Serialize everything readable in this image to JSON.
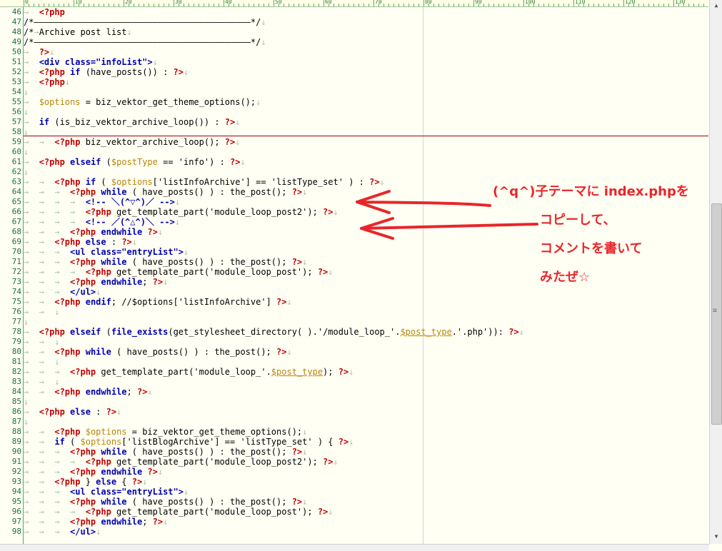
{
  "ruler": {
    "labels": [
      "0",
      "10",
      "20",
      "30",
      "40",
      "50",
      "60",
      "70",
      "80",
      "90",
      "100",
      "110",
      "120",
      "130"
    ]
  },
  "lines": [
    {
      "n": "46",
      "t": [
        [
          "marker",
          "→  "
        ],
        [
          "tag",
          "<?php"
        ]
      ]
    },
    {
      "n": "47",
      "t": [
        [
          "comment",
          "/*――――――――――――――――――――――――――――――――――――――――――*/"
        ],
        [
          "marker",
          "↓"
        ]
      ]
    },
    {
      "n": "48",
      "t": [
        [
          "comment",
          "/*"
        ],
        [
          "marker",
          "→"
        ],
        [
          "comment",
          "Archive post list"
        ],
        [
          "marker",
          "↓"
        ]
      ]
    },
    {
      "n": "49",
      "t": [
        [
          "comment",
          "/*――――――――――――――――――――――――――――――――――――――――――*/"
        ],
        [
          "marker",
          "↓"
        ]
      ]
    },
    {
      "n": "50",
      "t": [
        [
          "marker",
          "→  "
        ],
        [
          "tag",
          "?>"
        ],
        [
          "marker",
          "↓"
        ]
      ]
    },
    {
      "n": "51",
      "t": [
        [
          "marker",
          "→  "
        ],
        [
          "html",
          "<div class=\"infoList\">"
        ],
        [
          "marker",
          "↓"
        ]
      ]
    },
    {
      "n": "52",
      "t": [
        [
          "marker",
          "→  "
        ],
        [
          "tag",
          "<?php"
        ],
        [
          "default",
          " "
        ],
        [
          "keyword",
          "if"
        ],
        [
          "default",
          " (have_posts()) : "
        ],
        [
          "tag",
          "?>"
        ],
        [
          "marker",
          "↓"
        ]
      ]
    },
    {
      "n": "53",
      "t": [
        [
          "marker",
          "→  "
        ],
        [
          "tag",
          "<?php"
        ],
        [
          "marker",
          "↓"
        ]
      ]
    },
    {
      "n": "54",
      "t": [
        [
          "marker",
          "↓"
        ]
      ]
    },
    {
      "n": "55",
      "t": [
        [
          "marker",
          "→  "
        ],
        [
          "var",
          "$options"
        ],
        [
          "default",
          " = biz_vektor_get_theme_options();"
        ],
        [
          "marker",
          "↓"
        ]
      ]
    },
    {
      "n": "56",
      "t": [
        [
          "marker",
          "↓"
        ]
      ]
    },
    {
      "n": "57",
      "t": [
        [
          "marker",
          "→  "
        ],
        [
          "keyword",
          "if"
        ],
        [
          "default",
          " (is_biz_vektor_archive_loop()) : "
        ],
        [
          "tag",
          "?>"
        ],
        [
          "marker",
          "↓"
        ]
      ]
    },
    {
      "n": "58",
      "t": [
        [
          "marker",
          "↓"
        ]
      ]
    },
    {
      "n": "59",
      "t": [
        [
          "marker",
          "→  →  "
        ],
        [
          "tag",
          "<?php"
        ],
        [
          "default",
          " biz_vektor_archive_loop(); "
        ],
        [
          "tag",
          "?>"
        ],
        [
          "marker",
          "↓"
        ]
      ]
    },
    {
      "n": "60",
      "t": [
        [
          "marker",
          "↓"
        ]
      ]
    },
    {
      "n": "61",
      "t": [
        [
          "marker",
          "→  "
        ],
        [
          "tag",
          "<?php"
        ],
        [
          "default",
          " "
        ],
        [
          "keyword",
          "elseif"
        ],
        [
          "default",
          " ("
        ],
        [
          "var",
          "$postType"
        ],
        [
          "default",
          " == 'info') : "
        ],
        [
          "tag",
          "?>"
        ],
        [
          "marker",
          "↓"
        ]
      ]
    },
    {
      "n": "62",
      "t": [
        [
          "marker",
          "↓"
        ]
      ]
    },
    {
      "n": "63",
      "t": [
        [
          "marker",
          "→  →  "
        ],
        [
          "tag",
          "<?php"
        ],
        [
          "default",
          " "
        ],
        [
          "keyword",
          "if"
        ],
        [
          "default",
          " ( "
        ],
        [
          "var",
          "$options"
        ],
        [
          "default",
          "['listInfoArchive'] == 'listType_set' ) : "
        ],
        [
          "tag",
          "?>"
        ],
        [
          "marker",
          "↓"
        ]
      ]
    },
    {
      "n": "64",
      "t": [
        [
          "marker",
          "→  →  →  "
        ],
        [
          "tag",
          "<?php"
        ],
        [
          "default",
          " "
        ],
        [
          "keyword",
          "while"
        ],
        [
          "default",
          " ( have_posts() ) : the_post(); "
        ],
        [
          "tag",
          "?>"
        ],
        [
          "marker",
          "↓"
        ]
      ]
    },
    {
      "n": "65",
      "t": [
        [
          "marker",
          "→  →  →  →  "
        ],
        [
          "html",
          "<!-- ＼(^▽^)／ -->"
        ],
        [
          "marker",
          "↓"
        ]
      ]
    },
    {
      "n": "66",
      "t": [
        [
          "marker",
          "→  →  →  →  "
        ],
        [
          "tag",
          "<?php"
        ],
        [
          "default",
          " get_template_part('module_loop_post2'); "
        ],
        [
          "tag",
          "?>"
        ],
        [
          "marker",
          "↓"
        ]
      ]
    },
    {
      "n": "67",
      "t": [
        [
          "marker",
          "→  →  →  →  "
        ],
        [
          "html",
          "<!-- ／(^△^)＼ -->"
        ],
        [
          "marker",
          "↓"
        ]
      ]
    },
    {
      "n": "68",
      "t": [
        [
          "marker",
          "→  →  →  "
        ],
        [
          "tag",
          "<?php"
        ],
        [
          "default",
          " "
        ],
        [
          "keyword",
          "endwhile"
        ],
        [
          "default",
          " "
        ],
        [
          "tag",
          "?>"
        ],
        [
          "marker",
          "↓"
        ]
      ]
    },
    {
      "n": "69",
      "t": [
        [
          "marker",
          "→  →  "
        ],
        [
          "tag",
          "<?php"
        ],
        [
          "default",
          " "
        ],
        [
          "keyword",
          "else"
        ],
        [
          "default",
          " : "
        ],
        [
          "tag",
          "?>"
        ],
        [
          "marker",
          "↓"
        ]
      ]
    },
    {
      "n": "70",
      "t": [
        [
          "marker",
          "→  →  →  "
        ],
        [
          "html",
          "<ul class=\"entryList\">"
        ],
        [
          "marker",
          "↓"
        ]
      ]
    },
    {
      "n": "71",
      "t": [
        [
          "marker",
          "→  →  →  "
        ],
        [
          "tag",
          "<?php"
        ],
        [
          "default",
          " "
        ],
        [
          "keyword",
          "while"
        ],
        [
          "default",
          " ( have_posts() ) : the_post(); "
        ],
        [
          "tag",
          "?>"
        ],
        [
          "marker",
          "↓"
        ]
      ]
    },
    {
      "n": "72",
      "t": [
        [
          "marker",
          "→  →  →  →  "
        ],
        [
          "tag",
          "<?php"
        ],
        [
          "default",
          " get_template_part('module_loop_post'); "
        ],
        [
          "tag",
          "?>"
        ],
        [
          "marker",
          "↓"
        ]
      ]
    },
    {
      "n": "73",
      "t": [
        [
          "marker",
          "→  →  →  "
        ],
        [
          "tag",
          "<?php"
        ],
        [
          "default",
          " "
        ],
        [
          "keyword",
          "endwhile"
        ],
        [
          "default",
          "; "
        ],
        [
          "tag",
          "?>"
        ],
        [
          "marker",
          "↓"
        ]
      ]
    },
    {
      "n": "74",
      "t": [
        [
          "marker",
          "→  →  →  "
        ],
        [
          "html",
          "</ul>"
        ],
        [
          "marker",
          "↓"
        ]
      ]
    },
    {
      "n": "75",
      "t": [
        [
          "marker",
          "→  →  "
        ],
        [
          "tag",
          "<?php"
        ],
        [
          "default",
          " "
        ],
        [
          "keyword",
          "endif"
        ],
        [
          "default",
          "; //$options['listInfoArchive'] "
        ],
        [
          "tag",
          "?>"
        ],
        [
          "marker",
          "↓"
        ]
      ]
    },
    {
      "n": "76",
      "t": [
        [
          "marker",
          "→  →  ↓"
        ]
      ]
    },
    {
      "n": "77",
      "t": [
        [
          "marker",
          "↓"
        ]
      ]
    },
    {
      "n": "78",
      "t": [
        [
          "marker",
          "→  "
        ],
        [
          "tag",
          "<?php"
        ],
        [
          "default",
          " "
        ],
        [
          "keyword",
          "elseif"
        ],
        [
          "default",
          " ("
        ],
        [
          "keyword",
          "file_exists"
        ],
        [
          "default",
          "(get_stylesheet_directory( ).'/module_loop_'."
        ],
        [
          "under",
          "$post_type"
        ],
        [
          "default",
          ".'.php')): "
        ],
        [
          "tag",
          "?>"
        ],
        [
          "marker",
          "↓"
        ]
      ]
    },
    {
      "n": "79",
      "t": [
        [
          "marker",
          "→  →  ↓"
        ]
      ]
    },
    {
      "n": "80",
      "t": [
        [
          "marker",
          "→  →  "
        ],
        [
          "tag",
          "<?php"
        ],
        [
          "default",
          " "
        ],
        [
          "keyword",
          "while"
        ],
        [
          "default",
          " ( have_posts() ) : the_post(); "
        ],
        [
          "tag",
          "?>"
        ],
        [
          "marker",
          "↓"
        ]
      ]
    },
    {
      "n": "81",
      "t": [
        [
          "marker",
          "→  →  ↓"
        ]
      ]
    },
    {
      "n": "82",
      "t": [
        [
          "marker",
          "→  →  →  "
        ],
        [
          "tag",
          "<?php"
        ],
        [
          "default",
          " get_template_part('module_loop_'."
        ],
        [
          "under",
          "$post_type"
        ],
        [
          "default",
          "); "
        ],
        [
          "tag",
          "?>"
        ],
        [
          "marker",
          "↓"
        ]
      ]
    },
    {
      "n": "83",
      "t": [
        [
          "marker",
          "→  →  ↓"
        ]
      ]
    },
    {
      "n": "84",
      "t": [
        [
          "marker",
          "→  →  "
        ],
        [
          "tag",
          "<?php"
        ],
        [
          "default",
          " "
        ],
        [
          "keyword",
          "endwhile"
        ],
        [
          "default",
          "; "
        ],
        [
          "tag",
          "?>"
        ],
        [
          "marker",
          "↓"
        ]
      ]
    },
    {
      "n": "85",
      "t": [
        [
          "marker",
          "↓"
        ]
      ]
    },
    {
      "n": "86",
      "t": [
        [
          "marker",
          "→  "
        ],
        [
          "tag",
          "<?php"
        ],
        [
          "default",
          " "
        ],
        [
          "keyword",
          "else"
        ],
        [
          "default",
          " : "
        ],
        [
          "tag",
          "?>"
        ],
        [
          "marker",
          "↓"
        ]
      ]
    },
    {
      "n": "87",
      "t": [
        [
          "marker",
          "↓"
        ]
      ]
    },
    {
      "n": "88",
      "t": [
        [
          "marker",
          "→  →  "
        ],
        [
          "tag",
          "<?php"
        ],
        [
          "default",
          " "
        ],
        [
          "var",
          "$options"
        ],
        [
          "default",
          " = biz_vektor_get_theme_options();"
        ],
        [
          "marker",
          "↓"
        ]
      ]
    },
    {
      "n": "89",
      "t": [
        [
          "marker",
          "→  →  "
        ],
        [
          "keyword",
          "if"
        ],
        [
          "default",
          " ( "
        ],
        [
          "var",
          "$options"
        ],
        [
          "default",
          "['listBlogArchive'] == 'listType_set' ) { "
        ],
        [
          "tag",
          "?>"
        ],
        [
          "marker",
          "↓"
        ]
      ]
    },
    {
      "n": "90",
      "t": [
        [
          "marker",
          "→  →  →  "
        ],
        [
          "tag",
          "<?php"
        ],
        [
          "default",
          " "
        ],
        [
          "keyword",
          "while"
        ],
        [
          "default",
          " ( have_posts() ) : the_post(); "
        ],
        [
          "tag",
          "?>"
        ],
        [
          "marker",
          "↓"
        ]
      ]
    },
    {
      "n": "91",
      "t": [
        [
          "marker",
          "→  →  →  →  "
        ],
        [
          "tag",
          "<?php"
        ],
        [
          "default",
          " get_template_part('module_loop_post2'); "
        ],
        [
          "tag",
          "?>"
        ],
        [
          "marker",
          "↓"
        ]
      ]
    },
    {
      "n": "92",
      "t": [
        [
          "marker",
          "→  →  →  "
        ],
        [
          "tag",
          "<?php"
        ],
        [
          "default",
          " "
        ],
        [
          "keyword",
          "endwhile"
        ],
        [
          "default",
          " "
        ],
        [
          "tag",
          "?>"
        ],
        [
          "marker",
          "↓"
        ]
      ]
    },
    {
      "n": "93",
      "t": [
        [
          "marker",
          "→  →  "
        ],
        [
          "tag",
          "<?php"
        ],
        [
          "default",
          " } "
        ],
        [
          "keyword",
          "else"
        ],
        [
          "default",
          " { "
        ],
        [
          "tag",
          "?>"
        ],
        [
          "marker",
          "↓"
        ]
      ]
    },
    {
      "n": "94",
      "t": [
        [
          "marker",
          "→  →  →  "
        ],
        [
          "html",
          "<ul class=\"entryList\">"
        ],
        [
          "marker",
          "↓"
        ]
      ]
    },
    {
      "n": "95",
      "t": [
        [
          "marker",
          "→  →  →  "
        ],
        [
          "tag",
          "<?php"
        ],
        [
          "default",
          " "
        ],
        [
          "keyword",
          "while"
        ],
        [
          "default",
          " ( have_posts() ) : the_post(); "
        ],
        [
          "tag",
          "?>"
        ],
        [
          "marker",
          "↓"
        ]
      ]
    },
    {
      "n": "96",
      "t": [
        [
          "marker",
          "→  →  →  →  "
        ],
        [
          "tag",
          "<?php"
        ],
        [
          "default",
          " get_template_part('module_loop_post'); "
        ],
        [
          "tag",
          "?>"
        ],
        [
          "marker",
          "↓"
        ]
      ]
    },
    {
      "n": "97",
      "t": [
        [
          "marker",
          "→  →  →  "
        ],
        [
          "tag",
          "<?php"
        ],
        [
          "default",
          " "
        ],
        [
          "keyword",
          "endwhile"
        ],
        [
          "default",
          "; "
        ],
        [
          "tag",
          "?>"
        ],
        [
          "marker",
          "↓"
        ]
      ]
    },
    {
      "n": "98",
      "t": [
        [
          "marker",
          "→  →  →  "
        ],
        [
          "html",
          "</ul>"
        ],
        [
          "marker",
          "↓"
        ]
      ]
    }
  ],
  "annotation": {
    "lines": [
      "(^q^)子テーマに index.phpを",
      "コピーして、",
      "コメントを書いて",
      "みたぜ☆"
    ],
    "color": "#e8262a"
  },
  "colors": {
    "background": "#fffff4",
    "line_numbers": "#1e6f3a",
    "php_tag": "#c00000",
    "keyword": "#0000b0",
    "variable": "#b8860b",
    "cursor_line": "#a00000"
  }
}
